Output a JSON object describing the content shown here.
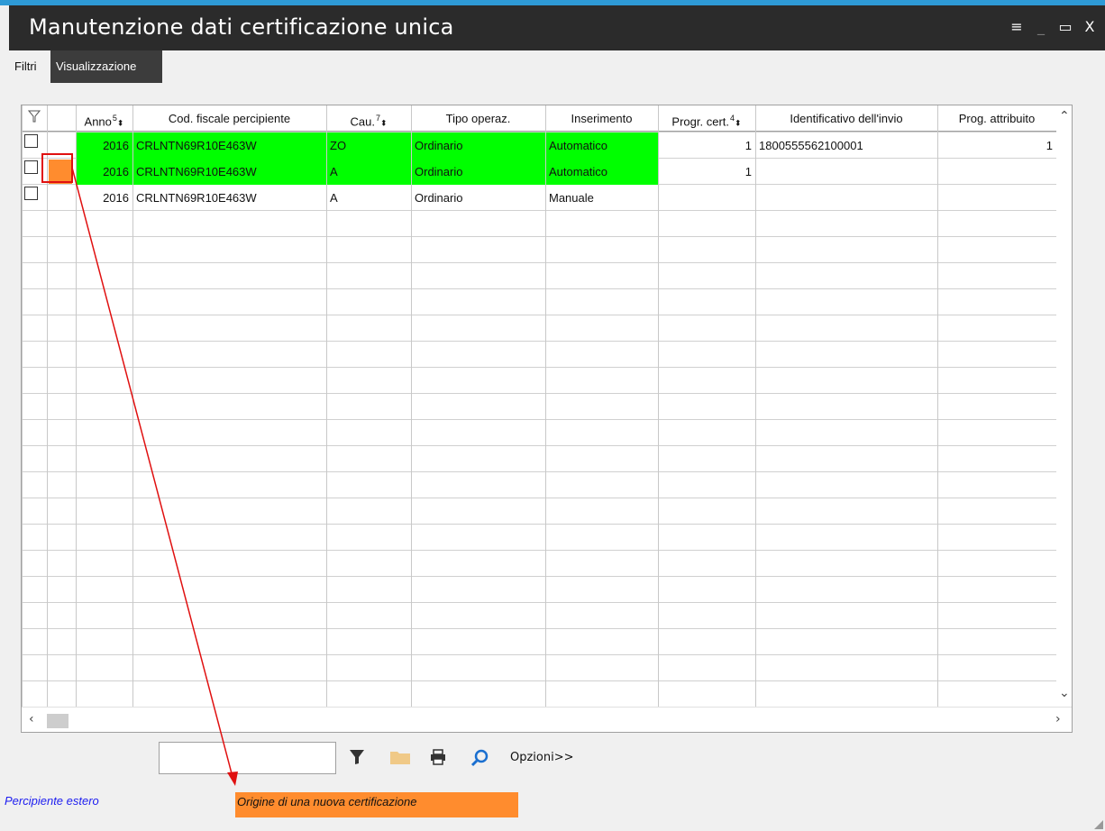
{
  "window": {
    "title": "Manutenzione dati certificazione unica",
    "controls": {
      "menu": "≡",
      "minimize": "_",
      "maximize": "▭",
      "close": "X"
    }
  },
  "tabs": [
    {
      "label": "Filtri",
      "active": false
    },
    {
      "label": "Visualizzazione",
      "active": true
    }
  ],
  "grid": {
    "columns": [
      {
        "key": "sel",
        "label": ""
      },
      {
        "key": "origin",
        "label": ""
      },
      {
        "key": "anno",
        "label": "Anno",
        "sort": "5"
      },
      {
        "key": "codfiscale",
        "label": "Cod. fiscale percipiente"
      },
      {
        "key": "cau",
        "label": "Cau.",
        "sort": "7"
      },
      {
        "key": "tipo",
        "label": "Tipo operaz."
      },
      {
        "key": "inserimento",
        "label": "Inserimento"
      },
      {
        "key": "progr",
        "label": "Progr. cert.",
        "sort": "4"
      },
      {
        "key": "ident",
        "label": "Identificativo dell'invio"
      },
      {
        "key": "progattr",
        "label": "Prog. attribuito"
      }
    ],
    "rows": [
      {
        "anno": "2016",
        "codfiscale": "CRLNTN69R10E463W",
        "cau": "ZO",
        "tipo": "Ordinario",
        "inserimento": "Automatico",
        "progr": "1",
        "ident": "1800555562100001",
        "progattr": "1",
        "highlight": true,
        "origin_marker": false
      },
      {
        "anno": "2016",
        "codfiscale": "CRLNTN69R10E463W",
        "cau": "A",
        "tipo": "Ordinario",
        "inserimento": "Automatico",
        "progr": "1",
        "ident": "",
        "progattr": "",
        "highlight": true,
        "origin_marker": true
      },
      {
        "anno": "2016",
        "codfiscale": "CRLNTN69R10E463W",
        "cau": "A",
        "tipo": "Ordinario",
        "inserimento": "Manuale",
        "progr": "",
        "ident": "",
        "progattr": "",
        "highlight": false,
        "origin_marker": false
      }
    ],
    "colors": {
      "highlight": "#00ff00",
      "origin": "#ff8c2e"
    }
  },
  "toolbar": {
    "search_value": "",
    "icons": [
      "filter-icon",
      "folder-icon",
      "printer-icon",
      "refresh-search-icon"
    ],
    "options_label": "Opzioni>>"
  },
  "legend": {
    "foreign": "Percipiente estero",
    "origin": "Origine di una nuova certificazione"
  }
}
